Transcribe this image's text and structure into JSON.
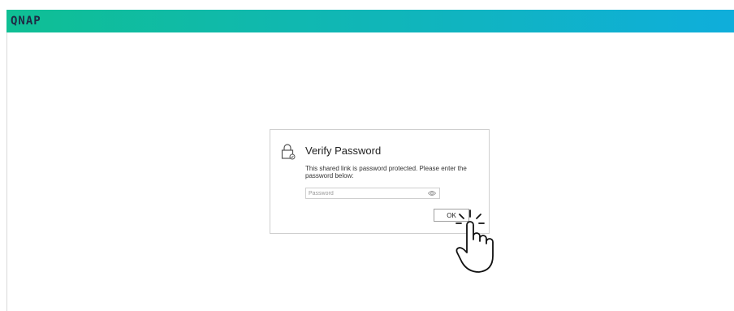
{
  "header": {
    "logo": "QNAP",
    "colors": {
      "gradient_start": "#0fbf94",
      "gradient_end": "#0faedb"
    }
  },
  "dialog": {
    "title": "Verify Password",
    "description": "This shared link is password protected. Please enter the password below:",
    "password_field": {
      "value": "",
      "placeholder": "Password"
    },
    "ok_label": "OK",
    "icons": {
      "title": "lock-icon",
      "field": "eye-icon",
      "cursor": "hand-pointer-icon"
    }
  }
}
